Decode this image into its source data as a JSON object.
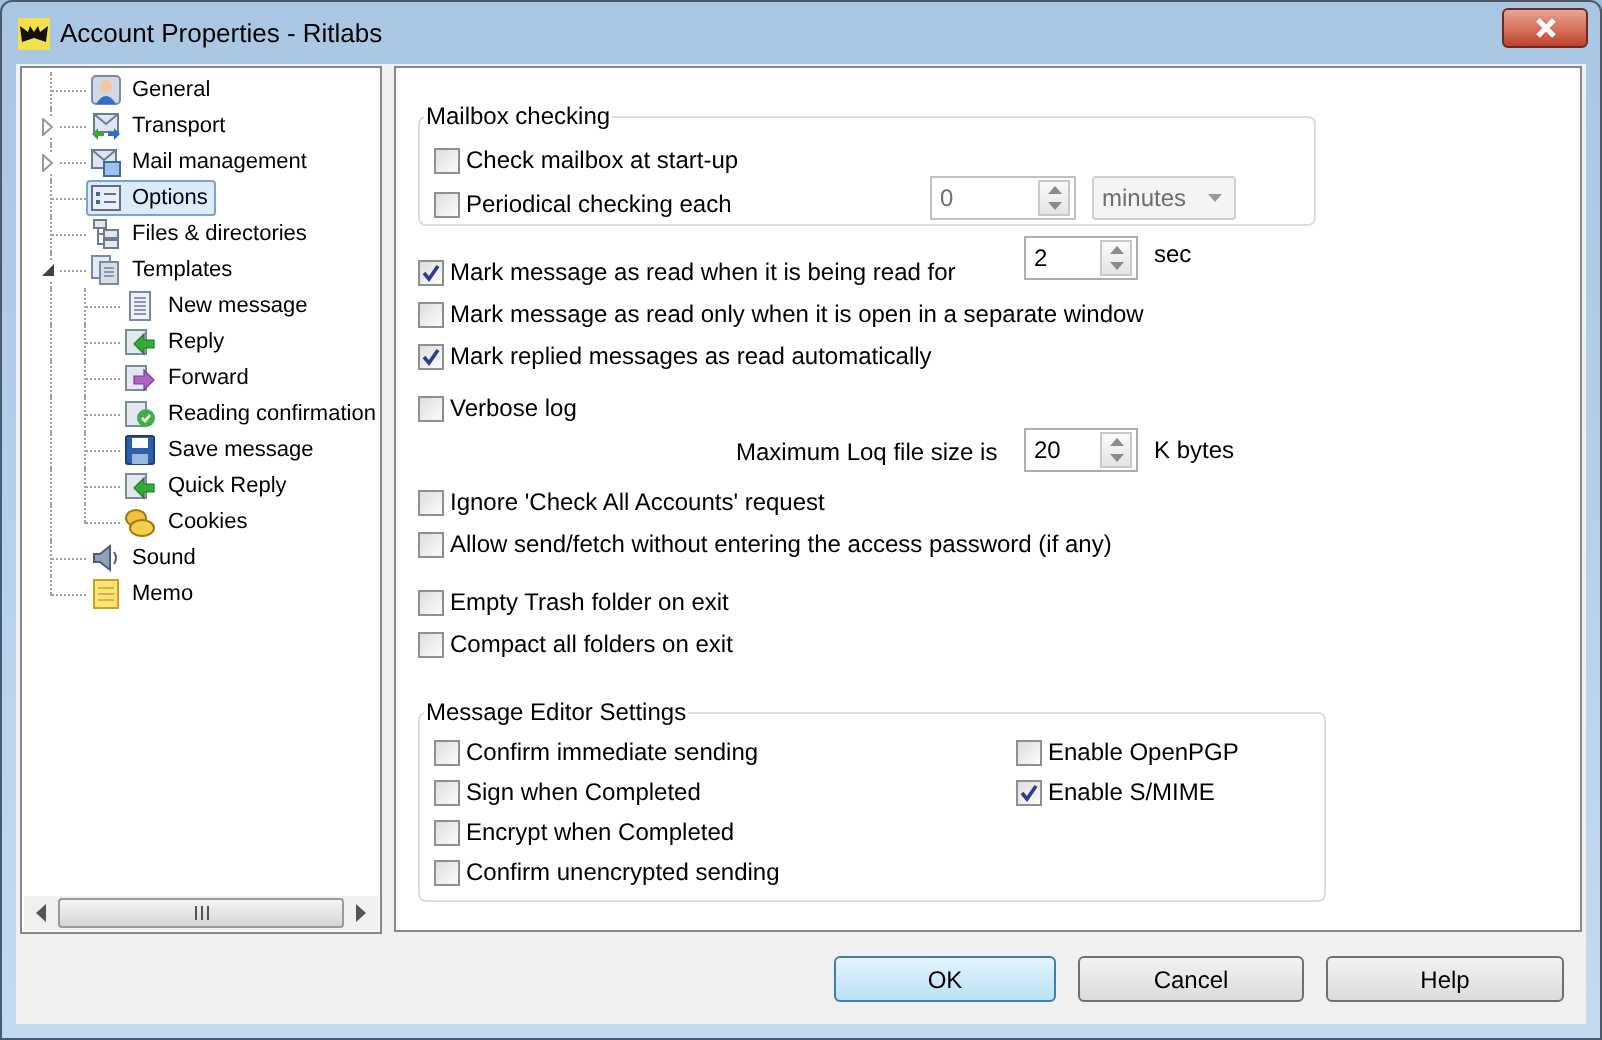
{
  "window": {
    "title": "Account Properties - Ritlabs"
  },
  "tree": [
    {
      "label": "General",
      "kind": "user",
      "selected": false
    },
    {
      "label": "Transport",
      "kind": "transport",
      "selected": false,
      "expanded": false
    },
    {
      "label": "Mail management",
      "kind": "mail",
      "selected": false,
      "expanded": false
    },
    {
      "label": "Options",
      "kind": "options",
      "selected": true
    },
    {
      "label": "Files & directories",
      "kind": "files",
      "selected": false
    },
    {
      "label": "Templates",
      "kind": "templates",
      "selected": false,
      "expanded": true,
      "children": [
        {
          "label": "New message",
          "kind": "page",
          "selected": false
        },
        {
          "label": "Reply",
          "kind": "reply",
          "selected": false
        },
        {
          "label": "Forward",
          "kind": "forward",
          "selected": false
        },
        {
          "label": "Reading confirmation",
          "kind": "confirm",
          "selected": false
        },
        {
          "label": "Save message",
          "kind": "save",
          "selected": false
        },
        {
          "label": "Quick Reply",
          "kind": "reply",
          "selected": false
        },
        {
          "label": "Cookies",
          "kind": "cookies",
          "selected": false
        }
      ]
    },
    {
      "label": "Sound",
      "kind": "sound",
      "selected": false
    },
    {
      "label": "Memo",
      "kind": "memo",
      "selected": false
    }
  ],
  "mailbox_checking": {
    "title": "Mailbox checking",
    "options": [
      {
        "label": "Check mailbox at start-up",
        "checked": false
      },
      {
        "label": "Periodical checking each",
        "checked": false
      }
    ],
    "interval": {
      "value": "0",
      "disabled": true
    },
    "unit": {
      "value": "minutes",
      "disabled": true
    }
  },
  "option_groups": [
    [
      {
        "kind": "checkbox",
        "label": "Mark message as read when it is being read for",
        "checked": true,
        "spin": "2",
        "unit": "sec"
      },
      {
        "kind": "checkbox",
        "label": "Mark message as read only when it is open in a separate window",
        "checked": false
      },
      {
        "kind": "checkbox",
        "label": "Mark replied messages as read automatically",
        "checked": true
      }
    ],
    [
      {
        "kind": "checkbox",
        "label": "Verbose log",
        "checked": false
      },
      {
        "kind": "spin",
        "label": "Maximum Loq file size is",
        "spin": "20",
        "unit": "K bytes"
      }
    ],
    [
      {
        "kind": "checkbox",
        "label": "Ignore 'Check All Accounts' request",
        "checked": false
      },
      {
        "kind": "checkbox",
        "label": "Allow send/fetch without entering the access password (if any)",
        "checked": false
      }
    ],
    [
      {
        "kind": "checkbox",
        "label": "Empty Trash folder on exit",
        "checked": false
      },
      {
        "kind": "checkbox",
        "label": "Compact all folders on exit",
        "checked": false
      }
    ]
  ],
  "editor_settings": {
    "title": "Message Editor Settings",
    "columns": [
      [
        {
          "label": "Confirm immediate sending",
          "checked": false
        },
        {
          "label": "Sign when Completed",
          "checked": false
        },
        {
          "label": "Encrypt when Completed",
          "checked": false
        },
        {
          "label": "Confirm unencrypted sending",
          "checked": false
        }
      ],
      [
        {
          "label": "Enable OpenPGP",
          "checked": false
        },
        {
          "label": "Enable S/MIME",
          "checked": true
        }
      ]
    ]
  },
  "buttons": [
    {
      "label": "OK",
      "default": true
    },
    {
      "label": "Cancel",
      "default": false
    },
    {
      "label": "Help",
      "default": false
    }
  ]
}
